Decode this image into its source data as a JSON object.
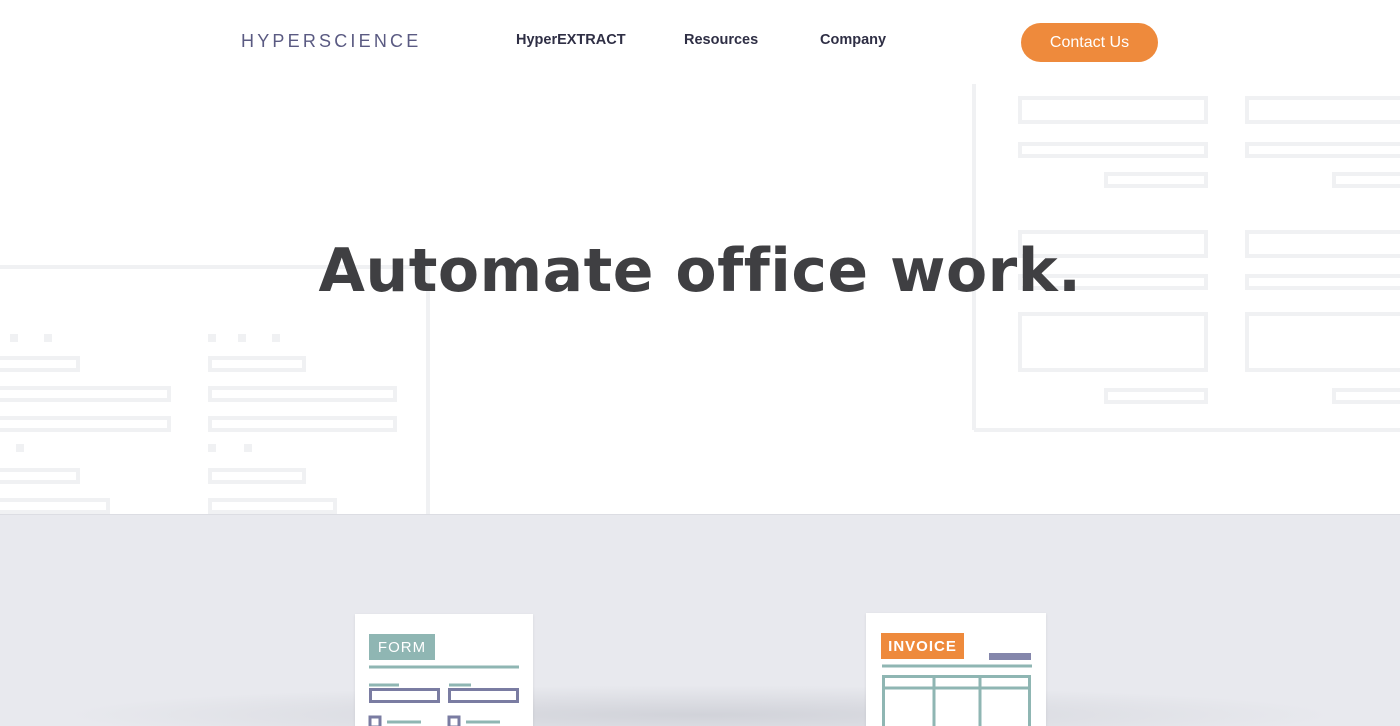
{
  "header": {
    "logo": "HYPERSCIENCE",
    "nav": [
      {
        "label": "HyperEXTRACT"
      },
      {
        "label": "Resources"
      },
      {
        "label": "Company"
      }
    ],
    "cta_label": "Contact Us"
  },
  "hero": {
    "headline": "Automate office work."
  },
  "cards": {
    "form_tag": "FORM",
    "invoice_tag": "INVOICE"
  },
  "colors": {
    "accent_orange": "#ee8a3c",
    "teal": "#8fb6b3",
    "navy": "#5a5a82",
    "headline_text": "#3f3f42",
    "section_gray": "#e8e9ee"
  },
  "icons": [
    "hyperscience-logo"
  ]
}
